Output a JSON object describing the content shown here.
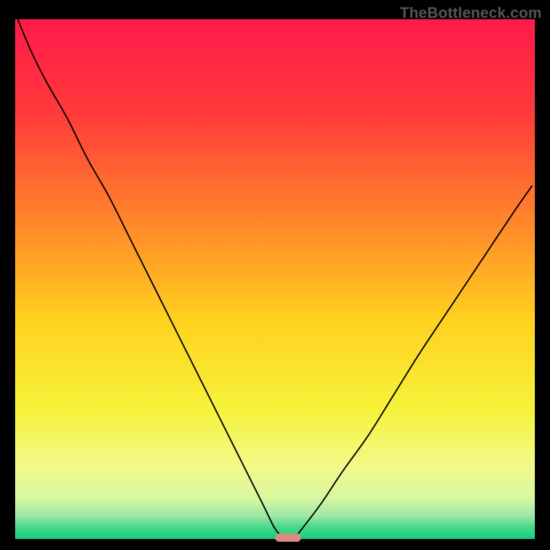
{
  "watermark": "TheBottleneck.com",
  "chart_data": {
    "type": "line",
    "title": "",
    "xlabel": "",
    "ylabel": "",
    "xlim": [
      0,
      100
    ],
    "ylim": [
      0,
      100
    ],
    "grid": false,
    "legend": false,
    "gradient_stops": [
      {
        "pos": 0.0,
        "color": "#ff1a4a"
      },
      {
        "pos": 0.18,
        "color": "#ff3a3a"
      },
      {
        "pos": 0.4,
        "color": "#ff8a2a"
      },
      {
        "pos": 0.58,
        "color": "#ffd21f"
      },
      {
        "pos": 0.75,
        "color": "#f6f23a"
      },
      {
        "pos": 0.86,
        "color": "#f2f98a"
      },
      {
        "pos": 0.92,
        "color": "#d9f7a0"
      },
      {
        "pos": 0.955,
        "color": "#9fe9a7"
      },
      {
        "pos": 0.975,
        "color": "#4fd98c"
      },
      {
        "pos": 1.0,
        "color": "#0fcf7a"
      }
    ],
    "series": [
      {
        "name": "bottleneck-curve",
        "color": "#000000",
        "x": [
          0.5,
          3,
          6,
          10,
          14,
          18,
          22,
          26,
          30,
          34,
          38,
          42,
          45,
          48,
          50,
          52,
          53.5,
          56,
          59,
          63,
          68,
          73,
          78,
          84,
          90,
          96,
          99.5
        ],
        "y": [
          100,
          94,
          88,
          81,
          73,
          66,
          58,
          50,
          42,
          34,
          26,
          18,
          12,
          6,
          2,
          0,
          0,
          3,
          7,
          13,
          20,
          28,
          36,
          45,
          54,
          63,
          68
        ]
      }
    ],
    "annotations": [
      {
        "name": "min-band",
        "x_start": 50,
        "x_end": 55,
        "y": 0,
        "color": "#d98b84"
      }
    ]
  }
}
